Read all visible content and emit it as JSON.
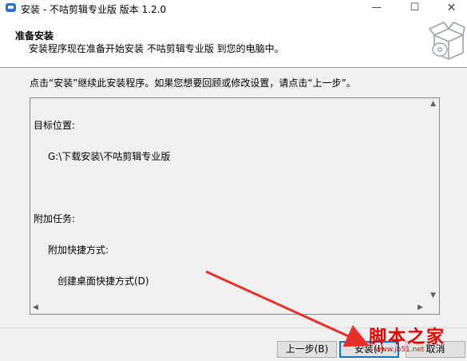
{
  "window": {
    "title": "安装 - 不咕剪辑专业版 版本 1.2.0",
    "min_glyph": "—",
    "max_glyph": "☐",
    "close_glyph": "✕"
  },
  "header": {
    "title": "准备安装",
    "description": "安装程序现在准备开始安装 不咕剪辑专业版 到您的电脑中。",
    "image_icon": "install-box-cd-icon"
  },
  "body": {
    "instruction": "点击“安装”继续此安装程序。如果您想要回顾或修改设置，请点击“上一步”。"
  },
  "memo": {
    "lines": [
      "目标位置:",
      "G:\\下载安装\\不咕剪辑专业版",
      "",
      "附加任务:",
      "附加快捷方式:",
      "创建桌面快捷方式(D)"
    ]
  },
  "buttons": {
    "back": "上一步(B)",
    "install": "安装(I)",
    "cancel": "取消"
  },
  "watermark": {
    "text": "脚本之家",
    "url": "www.jb51.net"
  },
  "colors": {
    "accent": "#0078d7",
    "annotation_arrow": "#e8302a",
    "watermark": "#e60000"
  }
}
